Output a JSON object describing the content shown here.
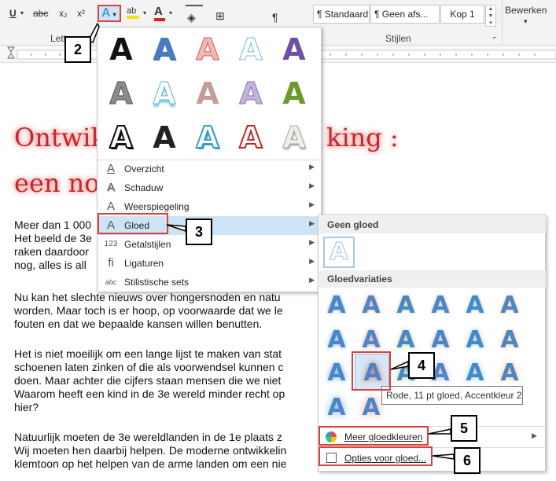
{
  "ribbon": {
    "font_group_label": "Lett",
    "styles_group_label": "Stijlen",
    "edit_label": "Bewerken",
    "styles": [
      "¶ Standaard",
      "¶ Geen afs...",
      "Kop 1"
    ]
  },
  "document": {
    "title_lines": [
      "Ontwik",
      "king :",
      "een no"
    ],
    "paragraphs": [
      "Meer dan 1 000",
      "Het beeld de 3e",
      "raken daardoor",
      "nog, alles is all",
      "Nu kan het slechte nieuws over hongersnoden en natu",
      "worden. Maar toch is er hoop, op voorwaarde dat we le",
      "fouten en dat we bepaalde kansen willen benutten.",
      "Het is niet moeilijk om een lange lijst te maken van stat",
      "schoenen laten zinken of die als voorwendsel kunnen c",
      "doen. Maar achter die cijfers staan mensen die we niet",
      "Waarom heeft een kind in de 3e wereld minder recht op",
      "hier?",
      "Natuurlijk moeten de 3e wereldlanden in de 1e plaats z",
      "Wij moeten hen daarbij helpen. De moderne ontwikkelin",
      "klemtoon op het helpen van de arme landen om een nie"
    ]
  },
  "menu": {
    "items": [
      {
        "label": "Overzicht",
        "icon": "outline-a-icon"
      },
      {
        "label": "Schaduw",
        "icon": "shadow-a-icon"
      },
      {
        "label": "Weerspiegeling",
        "icon": "reflection-a-icon"
      },
      {
        "label": "Gloed",
        "icon": "glow-a-icon"
      },
      {
        "label": "Getalstijlen",
        "icon": "number-style-icon"
      },
      {
        "label": "Ligaturen",
        "icon": "ligature-icon"
      },
      {
        "label": "Stilistische sets",
        "icon": "stylistic-set-icon"
      }
    ]
  },
  "submenu": {
    "no_glow_header": "Geen gloed",
    "variations_header": "Gloedvariaties",
    "more_colors": "Meer gloedkleuren",
    "options": "Opties voor gloed..."
  },
  "tooltip": "Rode, 11 pt gloed, Accentkleur 2",
  "callouts": [
    "2",
    "3",
    "4",
    "5",
    "6"
  ],
  "colors": {
    "accent_red": "#d9413a",
    "selection": "#cde4f7"
  }
}
